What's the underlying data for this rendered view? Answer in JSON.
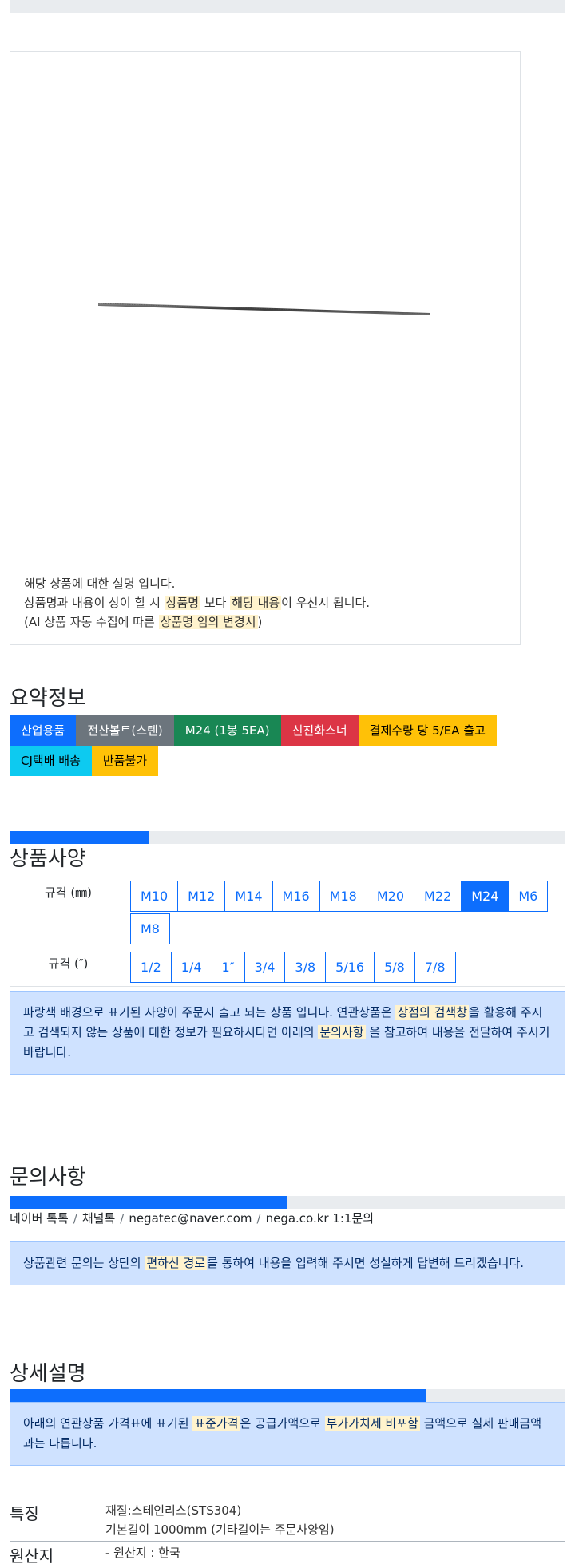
{
  "image_caption": {
    "line1": "해당 상품에 대한 설명 입니다.",
    "line2_pre": "상품명과 내용이 상이 할 시 ",
    "line2_hl1": "상품명",
    "line2_mid": " 보다 ",
    "line2_hl2": "해당 내용",
    "line2_post": "이 우선시 됩니다.",
    "line3_pre": "(AI 상품 자동 수집에 따른 ",
    "line3_hl": "상품명 임의 변경시",
    "line3_post": ")"
  },
  "summary": {
    "title": "요약정보",
    "badges": [
      {
        "label": "산업용품",
        "color": "#0d6efd"
      },
      {
        "label": "전산볼트(스텐)",
        "color": "#6c757d"
      },
      {
        "label": "M24 (1봉 5EA)",
        "color": "#198754"
      },
      {
        "label": "신진화스너",
        "color": "#dc3545"
      },
      {
        "label": "결제수량 당 5/EA 출고",
        "color": "#ffc107"
      },
      {
        "label": "CJ택배 배송",
        "color": "#0dcaf0"
      },
      {
        "label": "반품불가",
        "color": "#ffc107"
      }
    ]
  },
  "spec": {
    "progress": 0.25,
    "title": "상품사양",
    "rows": [
      {
        "label": "규격 (㎜)",
        "options": [
          "M10",
          "M12",
          "M14",
          "M16",
          "M18",
          "M20",
          "M22",
          "M24",
          "M6",
          "M8"
        ],
        "selected": "M24"
      },
      {
        "label": "규격 (″)",
        "options": [
          "1/2",
          "1/4",
          "1″",
          "3/4",
          "3/8",
          "5/16",
          "5/8",
          "7/8"
        ],
        "selected": ""
      }
    ],
    "notice_pre": "파랑색 배경으로 표기된 사양이 주문시 출고 되는 상품 입니다. 연관상품은 ",
    "notice_hl1": "상점의 검색창",
    "notice_mid": "을 활용해 주시고 검색되지 않는 상품에 대한 정보가 필요하시다면 아래의 ",
    "notice_hl2": "문의사항",
    "notice_post": " 을 참고하여 내용을 전달하여 주시기 바랍니다."
  },
  "inquiry": {
    "title": "문의사항",
    "progress": 0.5,
    "links": [
      "네이버 톡톡",
      "채널톡",
      "negatec@naver.com",
      "nega.co.kr 1:1문의"
    ],
    "separator": "/",
    "notice_pre": "상품관련 문의는 상단의 ",
    "notice_hl": "편하신 경로",
    "notice_post": "를 통하여 내용을 입력해 주시면 성실하게 답변해 드리겠습니다."
  },
  "detail": {
    "title": "상세설명",
    "progress": 0.75,
    "notice_pre": "아래의 연관상품 가격표에 표기된 ",
    "notice_hl1": "표준가격",
    "notice_mid": "은 공급가액으로 ",
    "notice_hl2": "부가가치세 비포함",
    "notice_post": " 금액으로 실제 판매금액과는 다릅니다.",
    "features_label": "특징",
    "features": [
      "재질:스테인리스(STS304)",
      "기본길이 1000mm (기타길이는 주문사양임)"
    ],
    "origin_label": "원산지",
    "origin_value": "- 원산지 : 한국"
  }
}
